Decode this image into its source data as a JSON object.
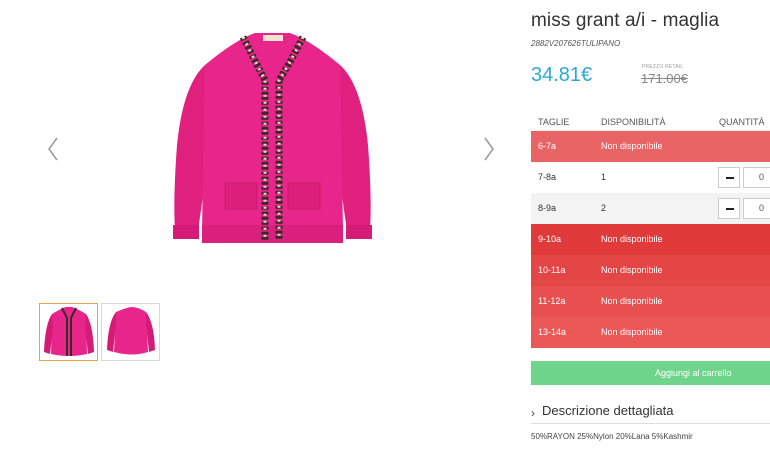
{
  "gallery": {
    "prev_icon": "chevron-left-icon",
    "next_icon": "chevron-right-icon",
    "active_thumbnail": 1,
    "garment_color": "#e8258a"
  },
  "product": {
    "title": "miss grant a/i - maglia",
    "sku": "2882V207626TULIPANO",
    "price": "34.81€",
    "retail_label": "PREZZO RETAIL",
    "retail_price": "171.00€",
    "price_color": "#2da8d8"
  },
  "size_table": {
    "headers": {
      "size": "TAGLIE",
      "availability": "DISPONIBILITÀ",
      "quantity": "QUANTITÀ"
    },
    "rows": [
      {
        "size": "6-7a",
        "availability": "Non disponibile"
      },
      {
        "size": "7-8a",
        "availability": "1",
        "quantity": "0"
      },
      {
        "size": "8-9a",
        "availability": "2",
        "quantity": "0"
      },
      {
        "size": "9-10a",
        "availability": "Non disponibile"
      },
      {
        "size": "10-11a",
        "availability": "Non disponibile"
      },
      {
        "size": "11-12a",
        "availability": "Non disponibile"
      },
      {
        "size": "13-14a",
        "availability": "Non disponibile"
      }
    ],
    "unavailable_color": "#e04848"
  },
  "cart": {
    "button_label": "Aggiungi al carrello",
    "button_color": "#6fd48c"
  },
  "description": {
    "toggle_label": "Descrizione dettagliata",
    "composition": "50%RAYON 25%Nylon 20%Lana 5%Kashmir"
  }
}
